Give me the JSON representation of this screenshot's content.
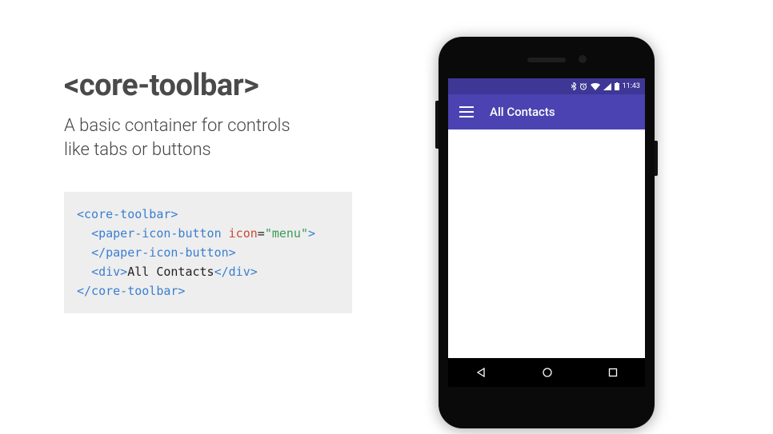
{
  "heading": "<core-toolbar>",
  "description_line1": "A basic container for controls",
  "description_line2": "like tabs or buttons",
  "code": {
    "l1_open": "<core-toolbar>",
    "l2_tag_open": "<paper-icon-button",
    "l2_attr": " icon",
    "l2_eq": "=",
    "l2_val": "\"menu\"",
    "l2_close": ">",
    "l3": "</paper-icon-button>",
    "l4_open": "<div>",
    "l4_text": "All Contacts",
    "l4_close": "</div>",
    "l5": "</core-toolbar>"
  },
  "phone": {
    "status_time": "11:43",
    "toolbar_title": "All Contacts"
  }
}
